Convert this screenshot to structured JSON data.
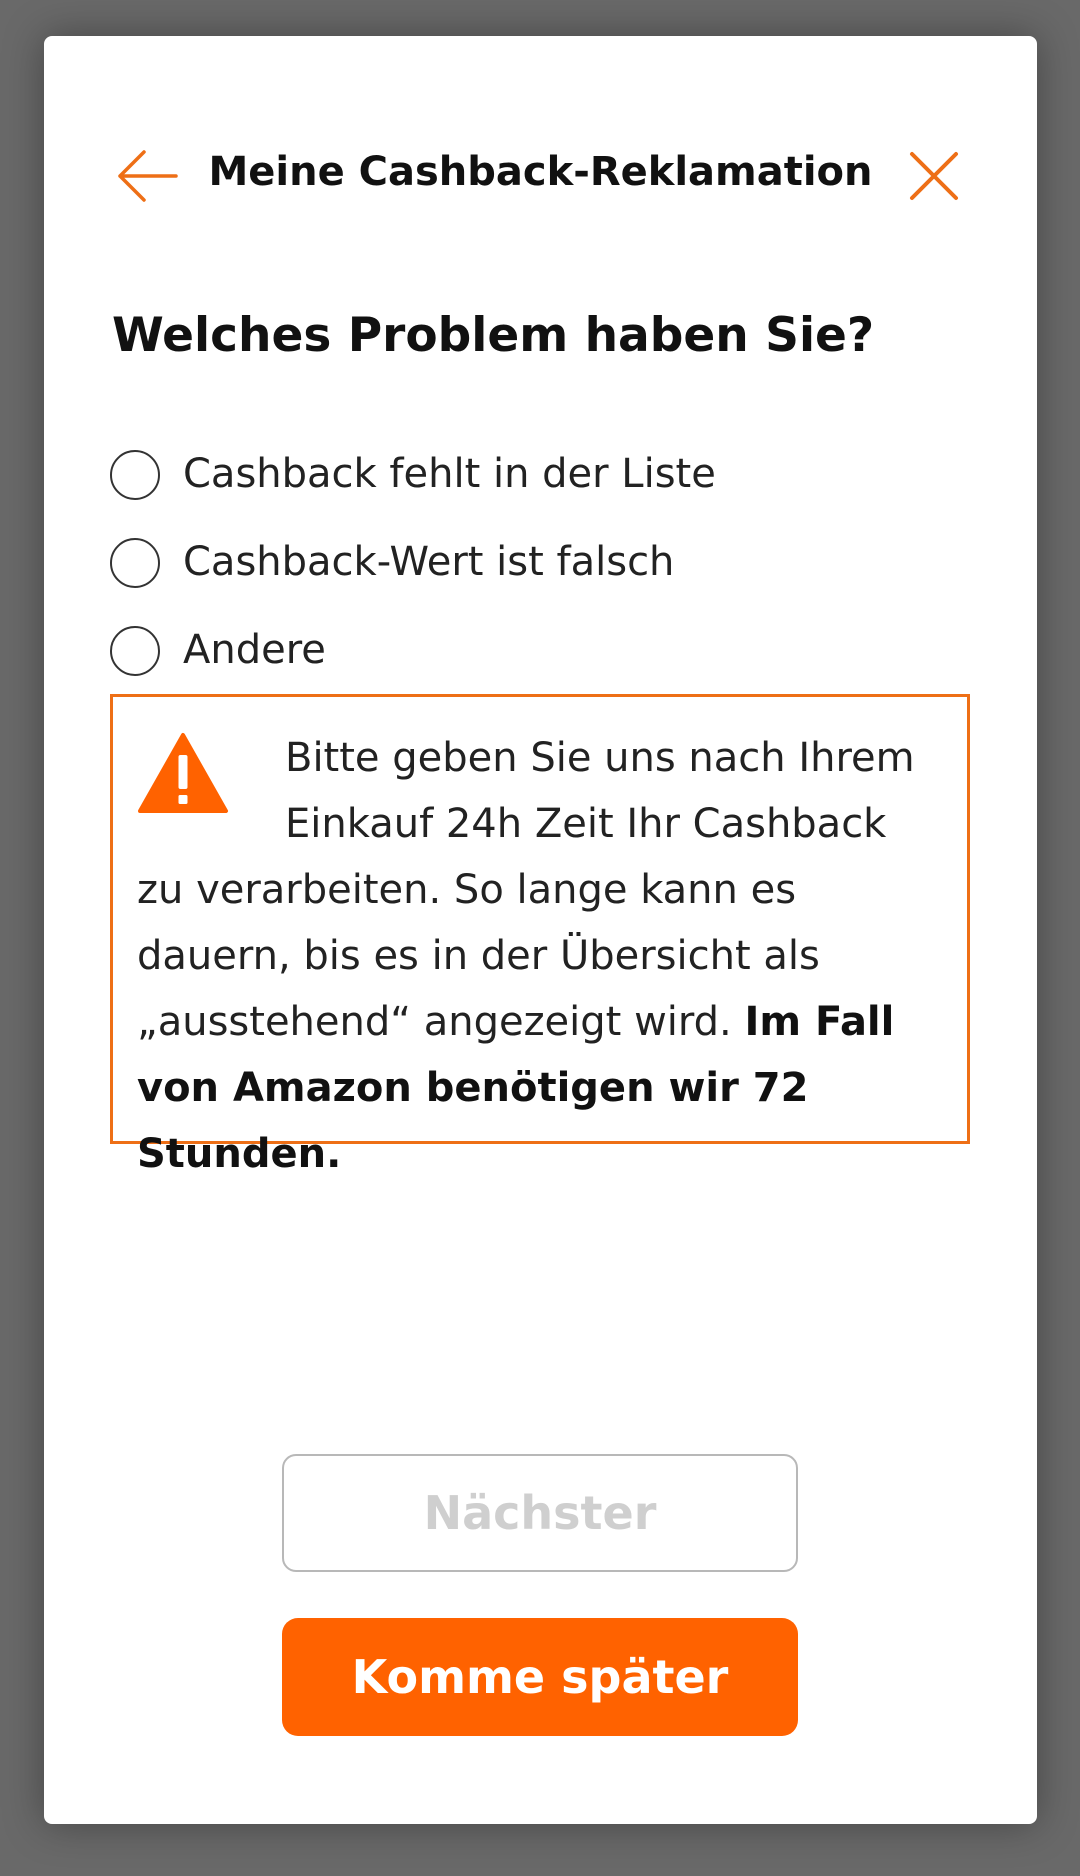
{
  "header": {
    "title": "Meine Cashback-Reklamation",
    "back_icon": "arrow-left-icon",
    "close_icon": "close-icon"
  },
  "question": "Welches Problem haben Sie?",
  "options": [
    {
      "label": "Cashback fehlt in der Liste",
      "selected": false
    },
    {
      "label": "Cashback-Wert ist falsch",
      "selected": false
    },
    {
      "label": "Andere",
      "selected": false
    }
  ],
  "notice": {
    "icon": "warning-icon",
    "text": "Bitte geben Sie uns nach Ihrem Einkauf 24h Zeit Ihr Cashback zu verarbeiten. So lange kann es dauern, bis es in der Übersicht als „ausstehend“ angezeigt wird.",
    "bold_text": "Im Fall von Amazon benötigen wir 72 Stunden."
  },
  "buttons": {
    "next_label": "Nächster",
    "next_enabled": false,
    "later_label": "Komme später"
  },
  "colors": {
    "accent": "#ff6200",
    "notice_border": "#ee6f16",
    "backdrop": "#696969"
  }
}
